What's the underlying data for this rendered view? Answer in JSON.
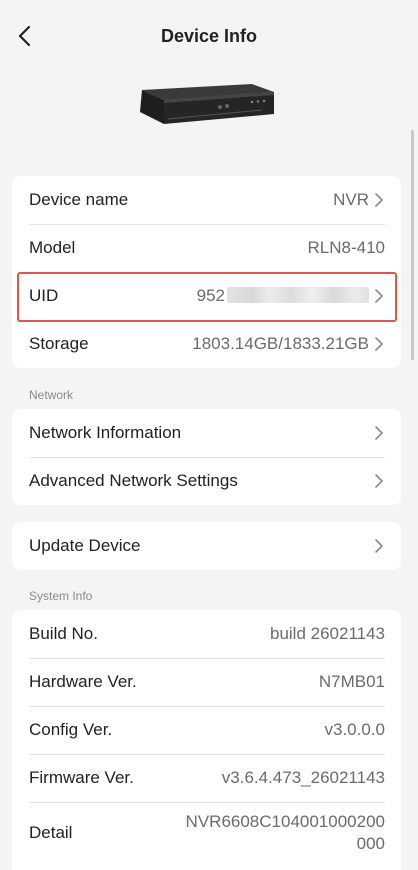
{
  "header": {
    "title": "Device Info"
  },
  "icons": {
    "back": "chevron-left-icon",
    "chevron": "chevron-right-icon"
  },
  "colors": {
    "highlight": "#e0564e",
    "background": "#f4f4f4"
  },
  "device_card": {
    "device_name": {
      "label": "Device name",
      "value": "NVR"
    },
    "model": {
      "label": "Model",
      "value": "RLN8-410"
    },
    "uid": {
      "label": "UID",
      "value_prefix": "952"
    },
    "storage": {
      "label": "Storage",
      "value": "1803.14GB/1833.21GB"
    }
  },
  "network": {
    "section_label": "Network",
    "items": [
      {
        "label": "Network Information"
      },
      {
        "label": "Advanced Network Settings"
      }
    ]
  },
  "update": {
    "label": "Update Device"
  },
  "system_info": {
    "section_label": "System Info",
    "build_no": {
      "label": "Build No.",
      "value": "build 26021143"
    },
    "hardware_ver": {
      "label": "Hardware Ver.",
      "value": "N7MB01"
    },
    "config_ver": {
      "label": "Config Ver.",
      "value": "v3.0.0.0"
    },
    "firmware_ver": {
      "label": "Firmware Ver.",
      "value": "v3.6.4.473_26021143"
    },
    "detail": {
      "label": "Detail",
      "value_line1": "NVR6608C104001000200",
      "value_line2": "000"
    }
  }
}
